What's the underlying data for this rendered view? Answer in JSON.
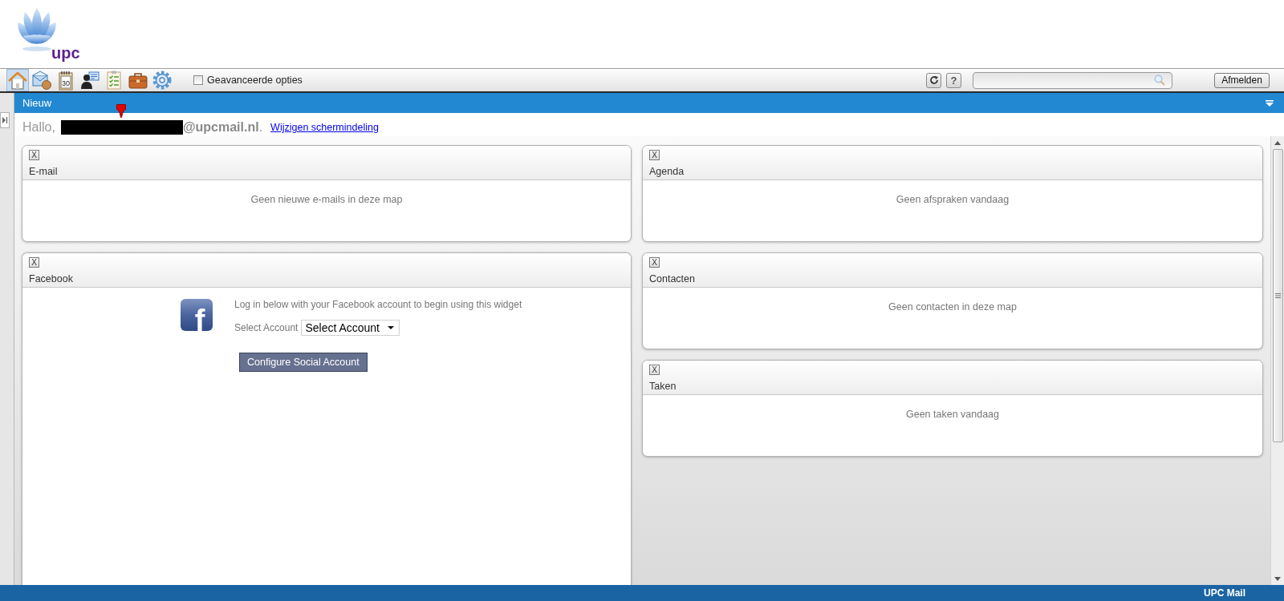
{
  "header": {
    "logo_text": "upc"
  },
  "toolbar": {
    "tools": [
      {
        "kind": "home",
        "selected": true
      },
      {
        "kind": "mail",
        "selected": false
      },
      {
        "kind": "calendar",
        "selected": false,
        "label": "30"
      },
      {
        "kind": "contacts",
        "selected": false
      },
      {
        "kind": "tasks",
        "selected": false
      },
      {
        "kind": "briefcase",
        "selected": false
      },
      {
        "kind": "settings",
        "selected": false
      }
    ],
    "advanced_options": {
      "label": "Geavanceerde opties",
      "checked": false
    },
    "help_button": "?",
    "logout_button": "Afmelden"
  },
  "nav_bar": {
    "title": "Nieuw"
  },
  "greeting": {
    "text": "Hallo,",
    "address": "**@upcmail.nl**.",
    "link": "Wijzigen schermindeling"
  },
  "columns": [
    {
      "widgets": [
        {
          "kind": "message",
          "close": "X",
          "title": "E-mail",
          "message": "Geen nieuwe e-mails in deze map"
        },
        {
          "kind": "facebook",
          "close": "X",
          "title": "Facebook",
          "logo_text": "f",
          "intro": "Log in below with your Facebook account to begin using this widget",
          "select_label": "Select Account",
          "select_value": "Select Account",
          "button": "Configure Social Account"
        }
      ]
    },
    {
      "widgets": [
        {
          "kind": "message",
          "close": "X",
          "title": "Agenda",
          "message": "Geen afspraken vandaag"
        },
        {
          "kind": "message",
          "close": "X",
          "title": "Contacten",
          "message": "Geen contacten in deze map"
        },
        {
          "kind": "message",
          "close": "X",
          "title": "Taken",
          "message": "Geen taken vandaag"
        }
      ]
    }
  ],
  "status_bar": {
    "title": "UPC Mail"
  }
}
